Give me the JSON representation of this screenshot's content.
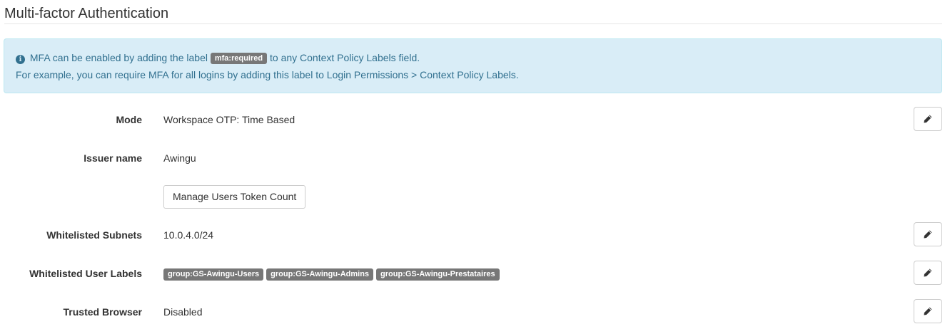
{
  "page": {
    "title": "Multi-factor Authentication"
  },
  "alert": {
    "line1_prefix": "MFA can be enabled by adding the label",
    "line1_code": "mfa:required",
    "line1_suffix": "to any Context Policy Labels field.",
    "line2": "For example, you can require MFA for all logins by adding this label to Login Permissions > Context Policy Labels."
  },
  "settings": {
    "mode": {
      "label": "Mode",
      "value": "Workspace OTP: Time Based"
    },
    "issuer": {
      "label": "Issuer name",
      "value": "Awingu"
    },
    "manage_button": "Manage Users Token Count",
    "subnets": {
      "label": "Whitelisted Subnets",
      "value": "10.0.4.0/24"
    },
    "user_labels": {
      "label": "Whitelisted User Labels",
      "tags": [
        "group:GS-Awingu-Users",
        "group:GS-Awingu-Admins",
        "group:GS-Awingu-Prestataires"
      ]
    },
    "trusted_browser": {
      "label": "Trusted Browser",
      "value": "Disabled"
    }
  },
  "icons": {
    "info": "info-circle-icon",
    "edit": "pencil-icon"
  },
  "colors": {
    "alert_bg": "#d9edf7",
    "alert_text": "#31708f",
    "tag_bg": "#777777"
  }
}
